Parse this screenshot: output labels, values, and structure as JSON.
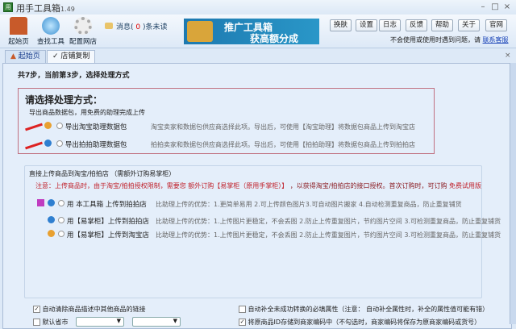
{
  "window": {
    "title": "用手工具箱",
    "version": "1.49",
    "minimize": "–",
    "maximize": "□",
    "close": "×"
  },
  "toolbar": {
    "home": "起始页",
    "find_tools": "查找工具",
    "config_store": "配置网店",
    "msg_prefix": "消息(",
    "msg_count": "0",
    "msg_suffix": ")条未读",
    "banner_line1": "推广工具箱",
    "banner_line2": "获高额分成",
    "buttons": [
      "换肤",
      "设置",
      "日志",
      "反馈",
      "帮助",
      "关于",
      "官网"
    ],
    "help_text": "不会使用或使用时遇到问题，请",
    "help_link": "联系客服"
  },
  "tabs": [
    {
      "label": "起始页"
    },
    {
      "label": "店铺复制"
    }
  ],
  "tab_close": "×",
  "step_text": "共7步，当前第3步，选择处理方式",
  "section1": {
    "title": "请选择处理方式：",
    "subtitle": "导出商品数据包，用免费的助理完成上传",
    "options": [
      {
        "label": "导出淘宝助理数据包",
        "desc": "淘宝卖家和数据包供应商选择此项。导出后，可使用【淘宝助理】将数据包商品上传到淘宝店"
      },
      {
        "label": "导出拍拍助理数据包",
        "desc": "拍拍卖家和数据包供应商选择此项。导出后，可使用【拍拍助理】将数据包商品上传到拍拍店"
      }
    ]
  },
  "section2": {
    "title": "直接上传商品到淘宝/拍拍店 （需额外订购易掌柜）",
    "notice_a": "注意：上传商品时，由于淘宝/拍拍授权限制，需要您",
    "notice_b": "额外订购【易掌柜（原用手掌柜）】",
    "notice_c": "，以获得淘宝/拍拍店的接口授权。首次订购时，可订购",
    "notice_d": "免费试用版",
    "options": [
      {
        "label": "用 本工具箱 上传到拍拍店",
        "desc": "比助理上传的优势：1.更简单易用 2.可上传颜色图片3.可自动图片搬家 4.自动检测重复商品，防止重复铺货"
      },
      {
        "label": "用【易掌柜】上传到拍拍店",
        "desc": "比助理上传的优势：1.上传图片更稳定，不会丢图 2.防止上传重复图片，节约图片空间 3.可检测重复商品，防止重复铺货"
      },
      {
        "label": "用【易掌柜】上传到淘宝店",
        "desc": "比助理上传的优势：1.上传图片更稳定，不会丢图 2.防止上传重复图片，节约图片空间 3.可检测重复商品，防止重复铺货"
      }
    ]
  },
  "bottom": {
    "opt1": "自动清除商品描述中其他商品的链接",
    "opt1_checked": true,
    "opt2": "默认省市",
    "opt2_checked": false,
    "opt3": "自动补全未成功转换的必填属性（注意： 自动补全属性时，补全的属性值可能有错）",
    "opt3_checked": false,
    "opt4": "将原商品ID存储到商家编码中（不勾选时，商家编码将保存为原商家编码或货号）",
    "opt4_checked": true
  },
  "colors": {
    "taobao": "#e8a030",
    "paipai": "#2f7fd0",
    "red": "#c0202a"
  }
}
